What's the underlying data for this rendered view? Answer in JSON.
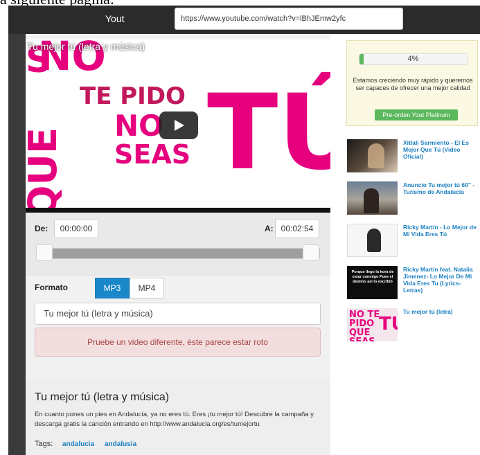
{
  "page_fragment": "a siguiente página:",
  "topbar": {
    "brand": "Yout",
    "url": "https://www.youtube.com/watch?v=lBhJEmw2yfc"
  },
  "video": {
    "title": "Tu mejor tú (letra y música)",
    "artwork": {
      "line1": "NO",
      "line2": "TE PIDO",
      "line3": "NO",
      "line4": "SEAS",
      "big": "TÚ",
      "vertical": "QUE",
      "corner": "S"
    }
  },
  "range": {
    "from_label": "De:",
    "from_value": "00:00:00",
    "to_label": "A:",
    "to_value": "00:02:54"
  },
  "format": {
    "label": "Formato",
    "options": [
      "MP3",
      "MP4"
    ],
    "selected": "MP3"
  },
  "title_field_value": "Tu mejor tú (letra y música)",
  "error_message": "Pruebe un video diferente, éste parece estar roto",
  "info": {
    "title": "Tu mejor tú (letra y música)",
    "description": "En cuanto pones un pies en Andalucía, ya no eres tú. Eres ¡tu mejor tú! Descubre la campaña y descarga gratis la canción entrando en http://www.andalucia.org/es/tumejortu",
    "tags_label": "Tags:",
    "tags": [
      "andalucia",
      "andalusia"
    ]
  },
  "promo": {
    "progress": 0.04,
    "progress_text": "4%",
    "text": "Estamos creciendo muy rápido y queremos ser capaces de ofrecer una mejor calidad",
    "button": "Pre-orden Yout Platinum"
  },
  "related": [
    {
      "title": "Xitlali Sarmiento - El Es Mejor Que Tú (Video Oficial)"
    },
    {
      "title": "Anuncio Tu mejor tú 60\" - Turismo de Andalucía"
    },
    {
      "title": "Ricky Martin - Lo Mejor de Mi Vida Eres Tú"
    },
    {
      "title": "Ricky Martin feat. Natalia Jimenez- Lo Mejor De Mi Vida Eres Tu (Lyrics- Letras)",
      "thumb_text": "Porque llego la hora de estar conmigo Pues el destino asi lo escribió"
    },
    {
      "title": "Tu mejor tú (letra)",
      "thumb_text_1": "NO TE PIDO QUE SEAS",
      "thumb_text_2": "TÚ"
    }
  ]
}
